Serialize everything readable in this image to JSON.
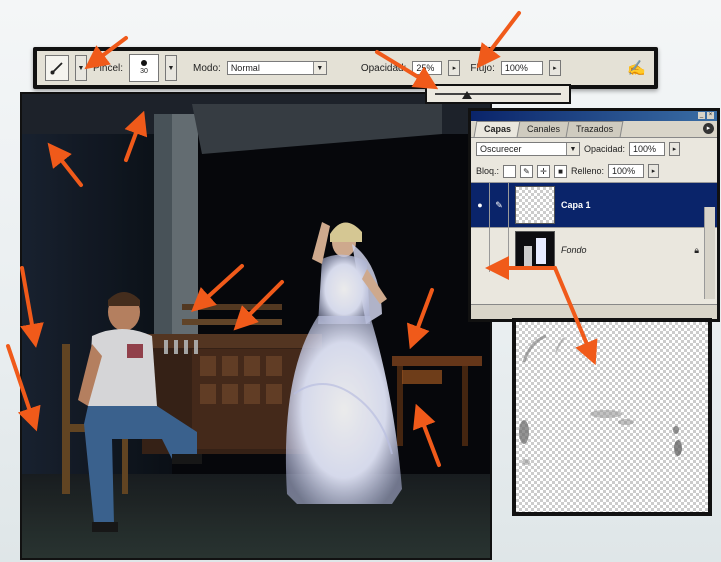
{
  "toolbar": {
    "brush_label": "Pincel:",
    "brush_size": "30",
    "mode_label": "Modo:",
    "mode_value": "Normal",
    "opacity_label": "Opacidad:",
    "opacity_value": "25%",
    "flow_label": "Flujo:",
    "flow_value": "100%",
    "opacity_slider_fraction": 0.25
  },
  "layers_panel": {
    "tabs": [
      "Capas",
      "Canales",
      "Trazados"
    ],
    "blend_mode": "Oscurecer",
    "opacity_label": "Opacidad:",
    "opacity_value": "100%",
    "lock_label": "Bloq.:",
    "fill_label": "Relleno:",
    "fill_value": "100%",
    "layers": [
      {
        "name": "Capa 1",
        "selected": true
      },
      {
        "name": "Fondo",
        "selected": false
      }
    ]
  },
  "colors": {
    "annotation_arrow": "#f05a1a",
    "selection": "#0a246a",
    "panel_bg": "#eae7de"
  },
  "icons": [
    "brush-icon",
    "airbrush-icon",
    "eye-icon",
    "lock-icon",
    "panel-menu-icon"
  ]
}
